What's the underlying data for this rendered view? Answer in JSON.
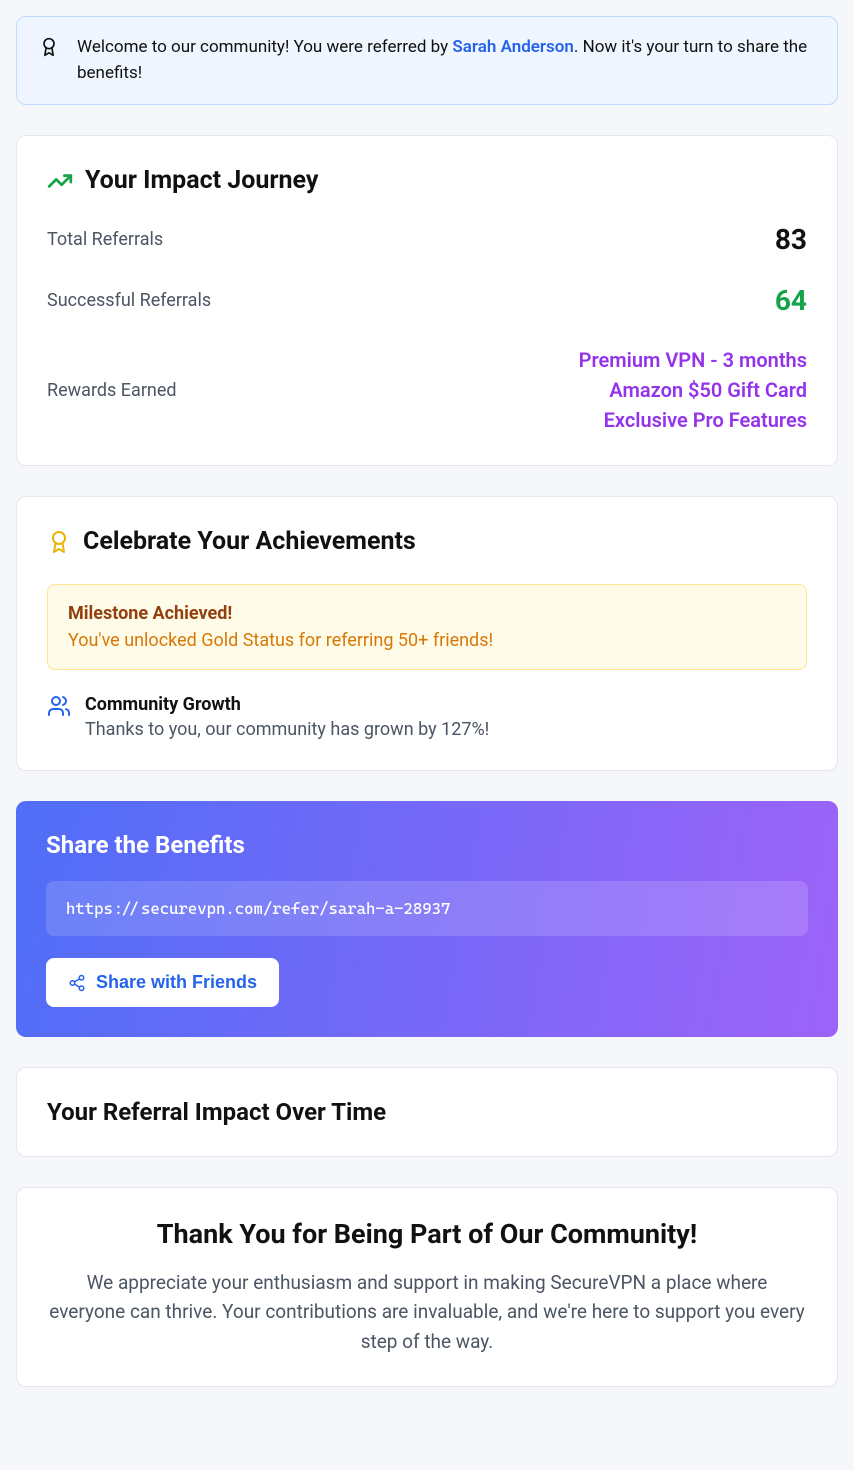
{
  "welcome": {
    "prefix": "Welcome to our community! You were referred by ",
    "referrer_name": "Sarah Anderson",
    "suffix": ". Now it's your turn to share the benefits!"
  },
  "impact": {
    "title": "Your Impact Journey",
    "total_label": "Total Referrals",
    "total_value": "83",
    "success_label": "Successful Referrals",
    "success_value": "64",
    "rewards_label": "Rewards Earned",
    "rewards": [
      "Premium VPN - 3 months",
      "Amazon $50 Gift Card",
      "Exclusive Pro Features"
    ]
  },
  "achievements": {
    "title": "Celebrate Your Achievements",
    "milestone_title": "Milestone Achieved!",
    "milestone_desc": "You've unlocked Gold Status for referring 50+ friends!",
    "community_title": "Community Growth",
    "community_desc": "Thanks to you, our community has grown by 127%!"
  },
  "share": {
    "title": "Share the Benefits",
    "url": "https://securevpn.com/refer/sarah-a-28937",
    "button_label": "Share with Friends"
  },
  "chart": {
    "title": "Your Referral Impact Over Time"
  },
  "thanks": {
    "title": "Thank You for Being Part of Our Community!",
    "body": "We appreciate your enthusiasm and support in making SecureVPN a place where everyone can thrive. Your contributions are invaluable, and we're here to support you every step of the way."
  }
}
